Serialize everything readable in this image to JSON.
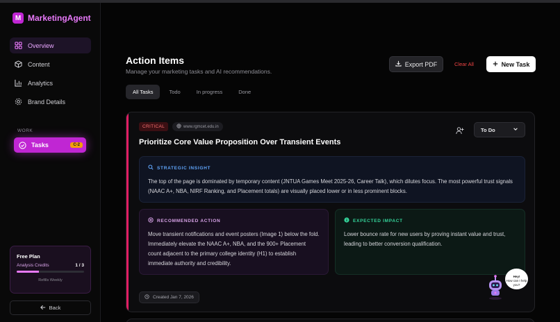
{
  "brand": {
    "logo_letter": "M",
    "name": "MarketingAgent",
    "accent": "#c026d3"
  },
  "sidebar": {
    "items": [
      {
        "label": "Overview",
        "icon": "grid-icon"
      },
      {
        "label": "Content",
        "icon": "cube-icon"
      },
      {
        "label": "Analytics",
        "icon": "chart-icon"
      },
      {
        "label": "Brand Details",
        "icon": "gear-icon"
      }
    ],
    "section_label": "WORK",
    "tasks": {
      "label": "Tasks",
      "icon": "check-circle-icon",
      "badge": "C-2"
    }
  },
  "plan": {
    "title": "Free Plan",
    "credits_label": "Analysis Credits",
    "credits_count": "1 / 3",
    "credits_fraction": 0.33,
    "refill_note": "Refills Weekly"
  },
  "back_label": "Back",
  "header": {
    "title": "Action Items",
    "subtitle": "Manage your marketing tasks and AI recommendations.",
    "export_label": "Export PDF",
    "clear_label": "Clear All",
    "new_task_label": "New Task"
  },
  "tabs": [
    "All Tasks",
    "Todo",
    "In progress",
    "Done"
  ],
  "active_tab": "All Tasks",
  "task": {
    "priority": "CRITICAL",
    "domain": "www.rgmcet.edu.in",
    "title": "Prioritize Core Value Proposition Over Transient Events",
    "status": "To Do",
    "insight": {
      "heading": "STRATEGIC INSIGHT",
      "body": "The top of the page is dominated by temporary content (JNTUA Games Meet 2025-26, Career Talk), which dilutes focus. The most powerful trust signals (NAAC A+, NBA, NIRF Ranking, and Placement totals) are visually placed lower or in less prominent blocks."
    },
    "action": {
      "heading": "RECOMMENDED ACTION",
      "body": "Move transient notifications and event posters (Image 1) below the fold. Immediately elevate the NAAC A+, NBA, and the 900+ Placement count adjacent to the primary college identity (H1) to establish immediate authority and credibility."
    },
    "impact": {
      "heading": "EXPECTED IMPACT",
      "body": "Lower bounce rate for new users by proving instant value and trust, leading to better conversion qualification."
    },
    "created": "Created Jan 7, 2026"
  },
  "assistant": {
    "greeting_line1": "Hey!",
    "greeting_line2": "How can I help you?"
  },
  "colors": {
    "critical": "#e11d63",
    "insight": "#60a5fa",
    "action": "#d8a3e8",
    "impact": "#34d399",
    "danger": "#ef4444"
  }
}
